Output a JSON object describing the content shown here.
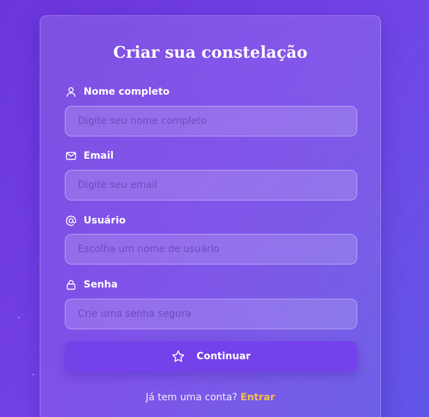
{
  "form": {
    "title": "Criar sua constelação",
    "fields": [
      {
        "label": "Nome completo",
        "placeholder": "Digite seu nome completo",
        "icon": "user-icon"
      },
      {
        "label": "Email",
        "placeholder": "Digite seu email",
        "icon": "mail-icon"
      },
      {
        "label": "Usuário",
        "placeholder": "Escolha um nome de usuário",
        "icon": "at-sign-icon"
      },
      {
        "label": "Senha",
        "placeholder": "Crie uma senha segura",
        "icon": "lock-icon"
      }
    ],
    "submit_label": "Continuar",
    "submit_icon": "star-icon"
  },
  "footer": {
    "prompt": "Já tem uma conta?",
    "link_label": "Entrar"
  },
  "colors": {
    "accent": "#7541ea",
    "link": "#f5c04a"
  }
}
